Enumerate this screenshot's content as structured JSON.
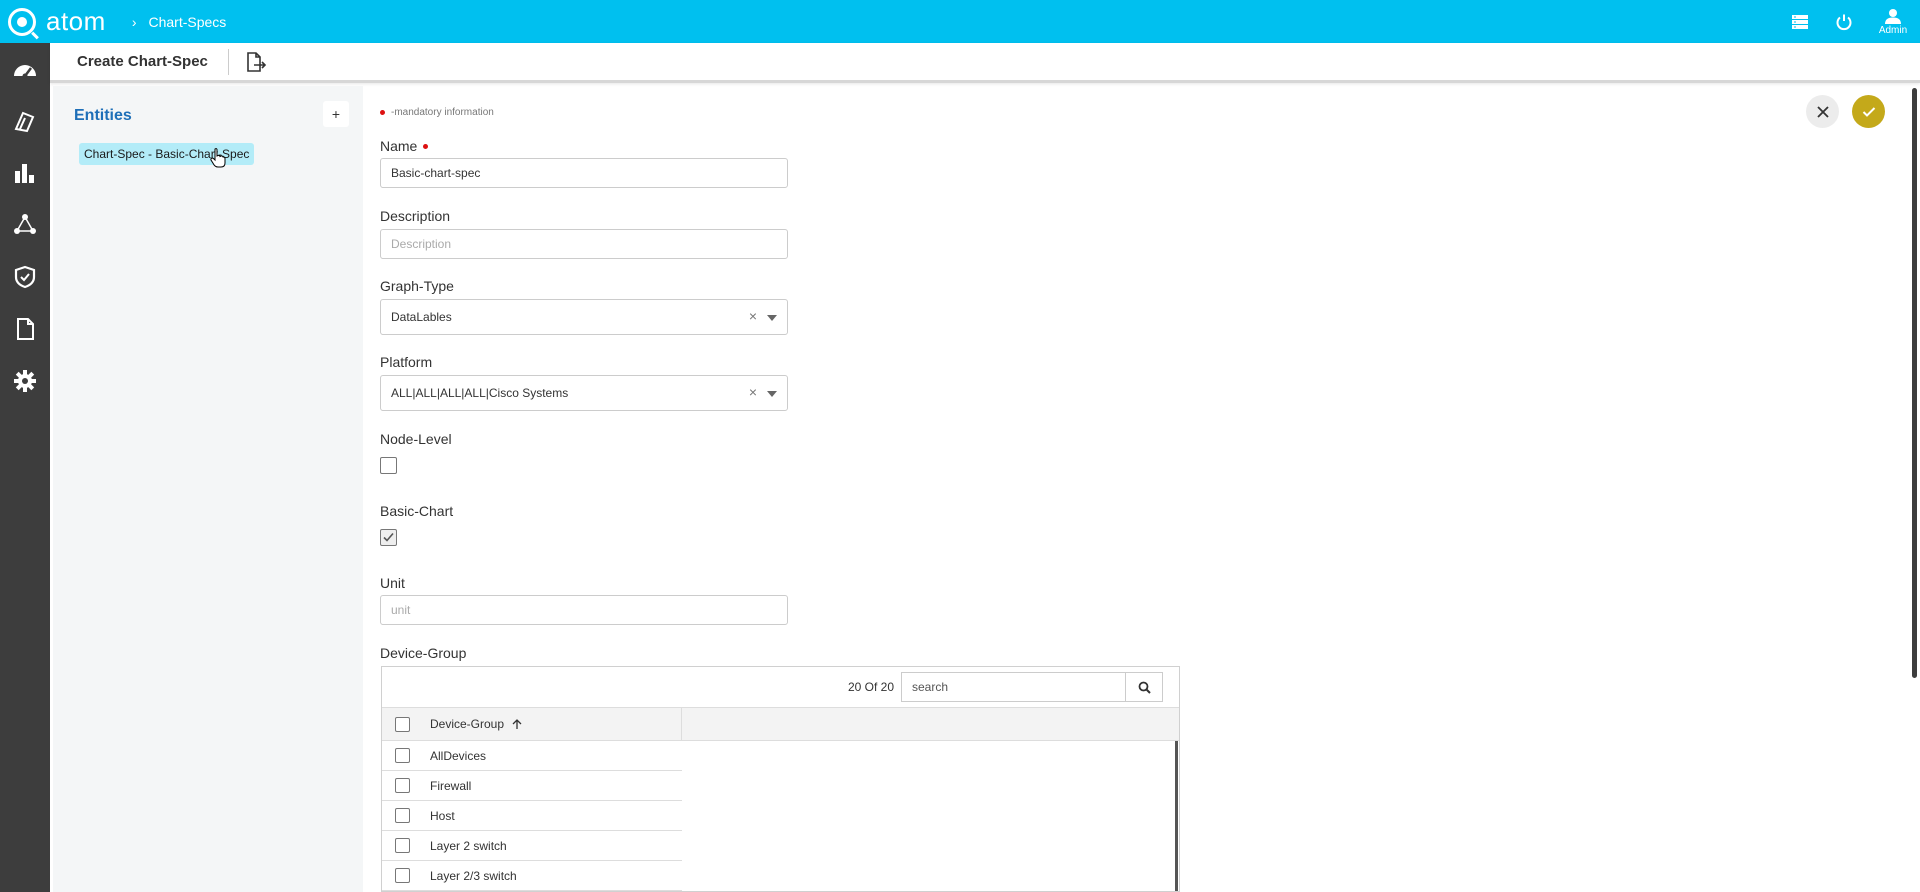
{
  "app": {
    "logo_text": "atom",
    "breadcrumb_sep": "›",
    "breadcrumb": "Chart-Specs",
    "admin_label": "Admin"
  },
  "icons": {
    "topbar": [
      "server-list-icon",
      "power-icon",
      "user-icon"
    ],
    "sidebar": [
      "dashboard-icon",
      "inventory-icon",
      "chart-icon",
      "topology-icon",
      "security-shield-icon",
      "document-icon",
      "settings-gear-icon"
    ]
  },
  "colors": {
    "topbar": "#00c0ef",
    "sidebar": "#3d3d3d",
    "entity_chip": "#b3ecf8",
    "confirm_button": "#c4a91a",
    "entities_title": "#1e6fb8"
  },
  "header": {
    "title": "Create Chart-Spec"
  },
  "entities": {
    "title": "Entities",
    "add_label": "+",
    "items": [
      "Chart-Spec - Basic-Chart-Spec"
    ]
  },
  "form": {
    "mandatory_note": "-mandatory information",
    "name": {
      "label": "Name",
      "value": "Basic-chart-spec"
    },
    "description": {
      "label": "Description",
      "placeholder": "Description"
    },
    "graph_type": {
      "label": "Graph-Type",
      "value": "DataLables"
    },
    "platform": {
      "label": "Platform",
      "value": "ALL|ALL|ALL|ALL|Cisco Systems"
    },
    "node_level": {
      "label": "Node-Level",
      "checked": false
    },
    "basic_chart": {
      "label": "Basic-Chart",
      "checked": true
    },
    "unit": {
      "label": "Unit",
      "placeholder": "unit"
    },
    "device_group": {
      "label": "Device-Group",
      "count": "20 Of 20",
      "search_placeholder": "search",
      "column": "Device-Group",
      "rows": [
        "AllDevices",
        "Firewall",
        "Host",
        "Layer 2 switch",
        "Layer 2/3 switch"
      ]
    }
  }
}
